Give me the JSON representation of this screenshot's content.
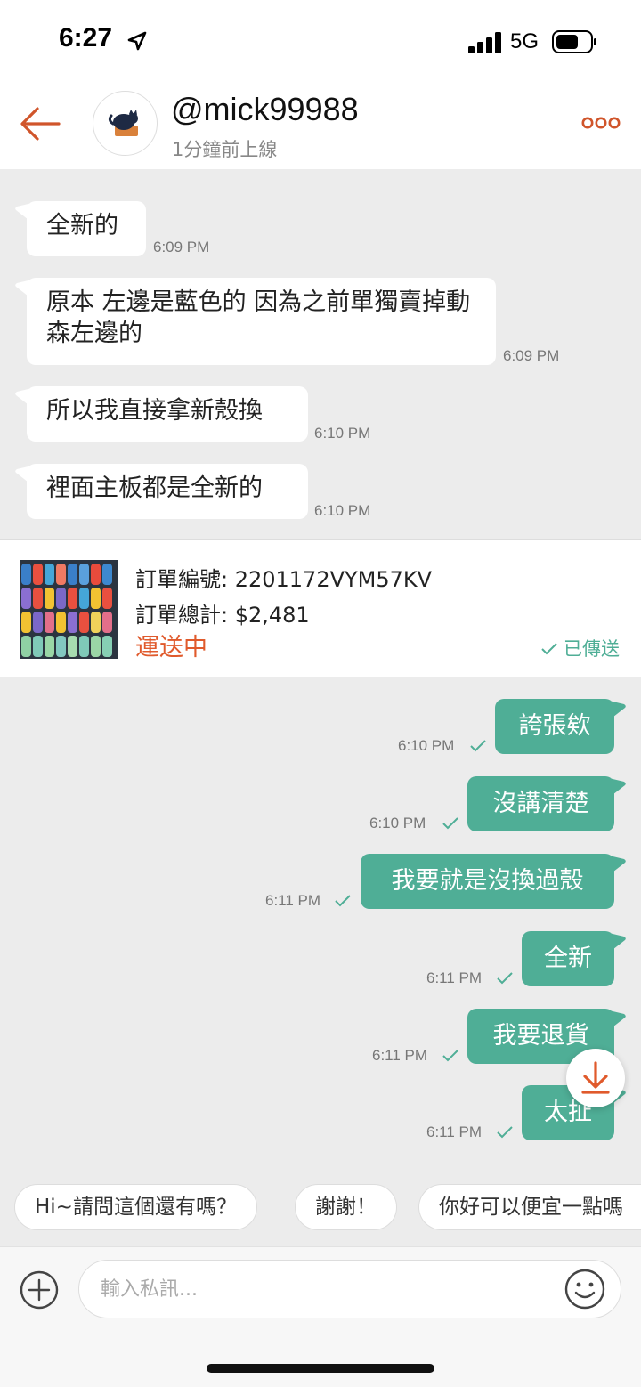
{
  "status_bar": {
    "time": "6:27",
    "network": "5G"
  },
  "header": {
    "title": "@mick99988",
    "subtitle": "1分鐘前上線"
  },
  "messages_in": [
    {
      "text": "全新的",
      "time": "6:09 PM"
    },
    {
      "text": "原本 左邊是藍色的  因為之前單獨賣掉動森左邊的",
      "time": "6:09 PM"
    },
    {
      "text": "所以我直接拿新殼換",
      "time": "6:10 PM"
    },
    {
      "text": "裡面主板都是全新的",
      "time": "6:10 PM"
    }
  ],
  "order": {
    "number_label": "訂單編號: 2201172VYM57KV",
    "total_label": "訂單總計: $2,481",
    "status": "運送中",
    "sent_label": "已傳送"
  },
  "messages_out": [
    {
      "text": "誇張欸",
      "time": "6:10 PM"
    },
    {
      "text": "沒講清楚",
      "time": "6:10 PM"
    },
    {
      "text": "我要就是沒換過殼",
      "time": "6:11 PM"
    },
    {
      "text": "全新",
      "time": "6:11 PM"
    },
    {
      "text": "我要退貨",
      "time": "6:11 PM"
    },
    {
      "text": "太扯",
      "time": "6:11 PM"
    }
  ],
  "quick_replies": [
    "Hi~請問這個還有嗎？",
    "謝謝！",
    "你好可以便宜一點嗎"
  ],
  "composer": {
    "placeholder": "輸入私訊..."
  },
  "colors": {
    "accent": "#e05a2c",
    "bubble_out": "#4fae96",
    "background": "#ececec"
  },
  "icons": [
    "location-arrow-icon",
    "signal-icon",
    "battery-icon",
    "back-arrow-icon",
    "more-icon",
    "check-icon",
    "scroll-down-icon",
    "plus-icon",
    "emoji-icon"
  ]
}
